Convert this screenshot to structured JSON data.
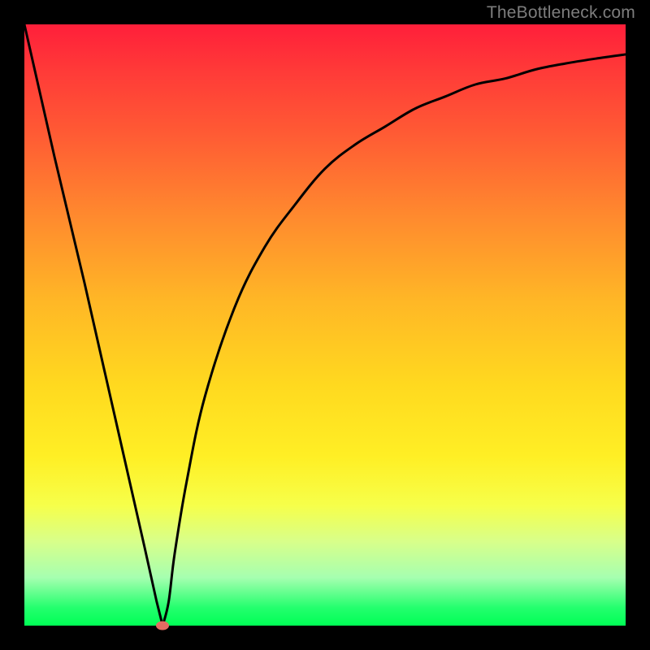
{
  "watermark": "TheBottleneck.com",
  "chart_data": {
    "type": "line",
    "title": "",
    "xlabel": "",
    "ylabel": "",
    "xlim": [
      0,
      100
    ],
    "ylim": [
      0,
      100
    ],
    "series": [
      {
        "name": "bottleneck-curve",
        "x": [
          0,
          5,
          10,
          15,
          20,
          22,
          23,
          24,
          25,
          27,
          30,
          35,
          40,
          45,
          50,
          55,
          60,
          65,
          70,
          75,
          80,
          85,
          90,
          95,
          100
        ],
        "values": [
          100,
          78,
          57,
          35,
          13,
          4,
          0,
          4,
          12,
          24,
          38,
          53,
          63,
          70,
          76,
          80,
          83,
          86,
          88,
          90,
          91,
          92.5,
          93.5,
          94.3,
          95
        ]
      }
    ],
    "marker": {
      "x": 23,
      "y": 0
    },
    "gradient_stops": [
      {
        "pct": 0,
        "color": "#ff1f3a"
      },
      {
        "pct": 50,
        "color": "#ffd91f"
      },
      {
        "pct": 100,
        "color": "#00ff55"
      }
    ]
  }
}
